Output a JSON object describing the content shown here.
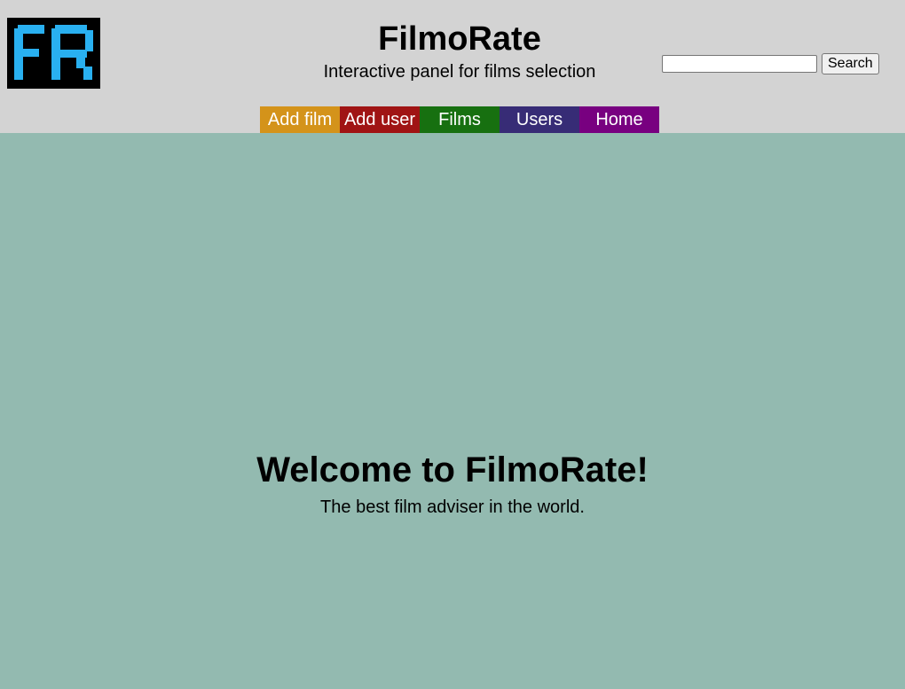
{
  "header": {
    "logo_alt": "FR",
    "title": "FilmoRate",
    "tagline": "Interactive panel for films selection",
    "logo_colors": {
      "background": "#000000",
      "letters": "#29b0f0"
    }
  },
  "search": {
    "value": "",
    "placeholder": "",
    "button_label": "Search"
  },
  "nav": {
    "items": [
      {
        "label": "Add film",
        "color": "#d4931a"
      },
      {
        "label": "Add user",
        "color": "#a01414"
      },
      {
        "label": "Films",
        "color": "#177010"
      },
      {
        "label": "Users",
        "color": "#372c76"
      },
      {
        "label": "Home",
        "color": "#780080"
      }
    ]
  },
  "main": {
    "heading": "Welcome to FilmoRate!",
    "subheading": "The best film adviser in the world.",
    "background": "#93bab0"
  }
}
